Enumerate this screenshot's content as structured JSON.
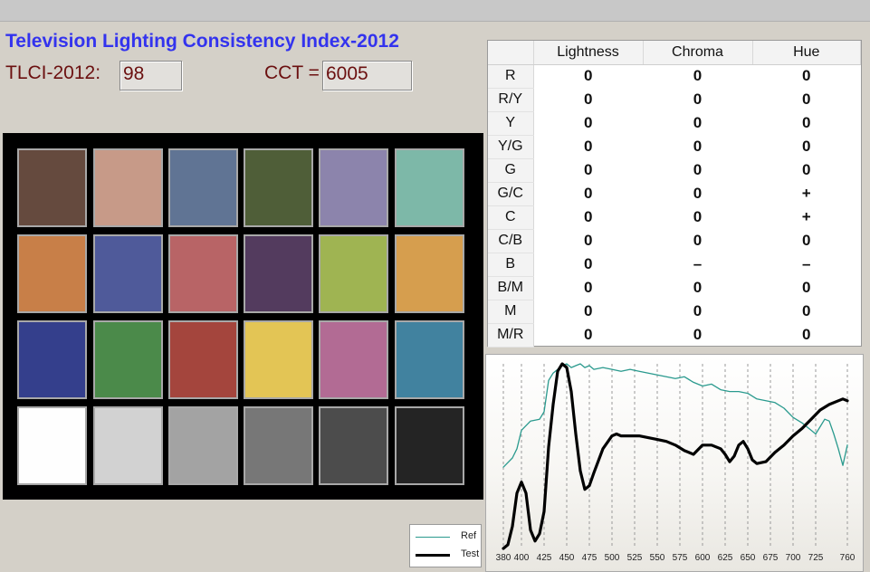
{
  "app": {
    "title": "Television Lighting Consistency Index-2012"
  },
  "metrics": {
    "tlci_label": "TLCI-2012:",
    "tlci_value": "98",
    "cct_label": "CCT =",
    "cct_value": "6005"
  },
  "checker": {
    "patches": [
      "#654a3e",
      "#c79a88",
      "#607494",
      "#4f5e38",
      "#8c84ac",
      "#7db8a8",
      "#c87f48",
      "#4f5a9a",
      "#b86466",
      "#533b5e",
      "#9fb452",
      "#d69e4e",
      "#343f8c",
      "#4b8a4a",
      "#a4453d",
      "#e3c555",
      "#b26b94",
      "#41829f",
      "#fefefe",
      "#d2d2d2",
      "#a3a3a3",
      "#777777",
      "#4c4c4c",
      "#242424"
    ]
  },
  "results_table": {
    "columns": [
      "",
      "Lightness",
      "Chroma",
      "Hue"
    ],
    "rows": [
      {
        "label": "R",
        "lightness": "0",
        "chroma": "0",
        "hue": "0"
      },
      {
        "label": "R/Y",
        "lightness": "0",
        "chroma": "0",
        "hue": "0"
      },
      {
        "label": "Y",
        "lightness": "0",
        "chroma": "0",
        "hue": "0"
      },
      {
        "label": "Y/G",
        "lightness": "0",
        "chroma": "0",
        "hue": "0"
      },
      {
        "label": "G",
        "lightness": "0",
        "chroma": "0",
        "hue": "0"
      },
      {
        "label": "G/C",
        "lightness": "0",
        "chroma": "0",
        "hue": "+"
      },
      {
        "label": "C",
        "lightness": "0",
        "chroma": "0",
        "hue": "+"
      },
      {
        "label": "C/B",
        "lightness": "0",
        "chroma": "0",
        "hue": "0"
      },
      {
        "label": "B",
        "lightness": "0",
        "chroma": "–",
        "hue": "–"
      },
      {
        "label": "B/M",
        "lightness": "0",
        "chroma": "0",
        "hue": "0"
      },
      {
        "label": "M",
        "lightness": "0",
        "chroma": "0",
        "hue": "0"
      },
      {
        "label": "M/R",
        "lightness": "0",
        "chroma": "0",
        "hue": "0"
      }
    ]
  },
  "legend": {
    "ref_label": "Ref",
    "test_label": "Test"
  },
  "colors": {
    "ref": "#2a9a8e",
    "test": "#000000",
    "title": "#3333ee",
    "value_text": "#6b1010"
  },
  "chart_data": {
    "type": "line",
    "xlabel": "",
    "ylabel": "",
    "xlim": [
      375,
      765
    ],
    "ylim": [
      0,
      1
    ],
    "x_ticks": [
      380,
      400,
      425,
      450,
      475,
      500,
      525,
      550,
      575,
      600,
      625,
      650,
      675,
      700,
      725,
      760
    ],
    "grid": "vertical dashed",
    "series": [
      {
        "name": "Ref",
        "x": [
          380,
          390,
          395,
          400,
          410,
          420,
          425,
          430,
          435,
          440,
          445,
          450,
          455,
          460,
          465,
          470,
          475,
          480,
          490,
          500,
          510,
          520,
          530,
          540,
          550,
          560,
          570,
          580,
          590,
          600,
          610,
          620,
          630,
          640,
          650,
          660,
          670,
          680,
          690,
          700,
          710,
          715,
          720,
          725,
          730,
          735,
          740,
          745,
          750,
          755,
          760
        ],
        "y": [
          0.44,
          0.49,
          0.54,
          0.64,
          0.69,
          0.7,
          0.74,
          0.91,
          0.95,
          0.97,
          0.99,
          1.0,
          0.98,
          0.99,
          1.0,
          0.98,
          0.99,
          0.97,
          0.98,
          0.97,
          0.96,
          0.97,
          0.96,
          0.95,
          0.94,
          0.93,
          0.92,
          0.93,
          0.9,
          0.88,
          0.89,
          0.86,
          0.85,
          0.85,
          0.84,
          0.81,
          0.8,
          0.79,
          0.76,
          0.71,
          0.68,
          0.66,
          0.64,
          0.62,
          0.66,
          0.7,
          0.69,
          0.62,
          0.54,
          0.45,
          0.56
        ]
      },
      {
        "name": "Test",
        "x": [
          380,
          385,
          390,
          395,
          400,
          405,
          410,
          415,
          420,
          425,
          430,
          435,
          440,
          445,
          450,
          455,
          460,
          465,
          470,
          475,
          480,
          490,
          500,
          505,
          510,
          520,
          530,
          540,
          550,
          560,
          570,
          580,
          585,
          590,
          600,
          610,
          620,
          625,
          630,
          635,
          640,
          645,
          650,
          655,
          660,
          670,
          680,
          690,
          700,
          710,
          720,
          730,
          740,
          750,
          755,
          760
        ],
        "y": [
          0.0,
          0.02,
          0.12,
          0.3,
          0.36,
          0.3,
          0.1,
          0.04,
          0.08,
          0.2,
          0.55,
          0.78,
          0.96,
          1.0,
          0.98,
          0.85,
          0.62,
          0.42,
          0.32,
          0.34,
          0.41,
          0.54,
          0.61,
          0.62,
          0.61,
          0.61,
          0.61,
          0.6,
          0.59,
          0.58,
          0.56,
          0.53,
          0.52,
          0.51,
          0.56,
          0.56,
          0.54,
          0.51,
          0.47,
          0.5,
          0.56,
          0.58,
          0.54,
          0.48,
          0.46,
          0.47,
          0.52,
          0.56,
          0.61,
          0.65,
          0.7,
          0.75,
          0.78,
          0.8,
          0.81,
          0.8
        ]
      }
    ]
  }
}
